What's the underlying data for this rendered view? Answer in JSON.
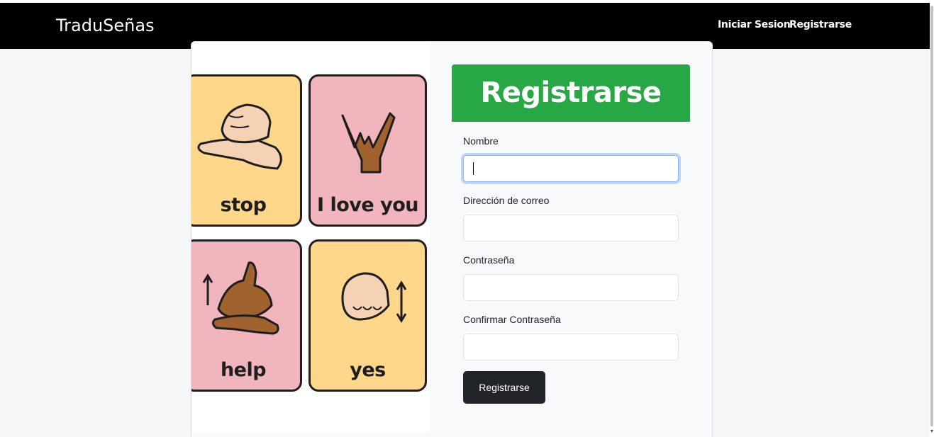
{
  "navbar": {
    "brand": "TraduSeñas",
    "links": [
      {
        "label": "Iniciar Sesion"
      },
      {
        "label": "Registrarse"
      }
    ]
  },
  "image_panel": {
    "cards": [
      {
        "word": "stop",
        "color": "#ffd78a"
      },
      {
        "word": "I love you",
        "color": "#f0b5bd"
      },
      {
        "word": "help",
        "color": "#f0b5bd"
      },
      {
        "word": "yes",
        "color": "#ffd78a"
      }
    ]
  },
  "form": {
    "title": "Registrarse",
    "header_color": "#28a745",
    "fields": [
      {
        "label": "Nombre",
        "value": "",
        "focused": true
      },
      {
        "label": "Dirección de correo",
        "value": ""
      },
      {
        "label": "Contraseña",
        "value": ""
      },
      {
        "label": "Confirmar Contraseña",
        "value": ""
      }
    ],
    "submit_label": "Registrarse"
  }
}
